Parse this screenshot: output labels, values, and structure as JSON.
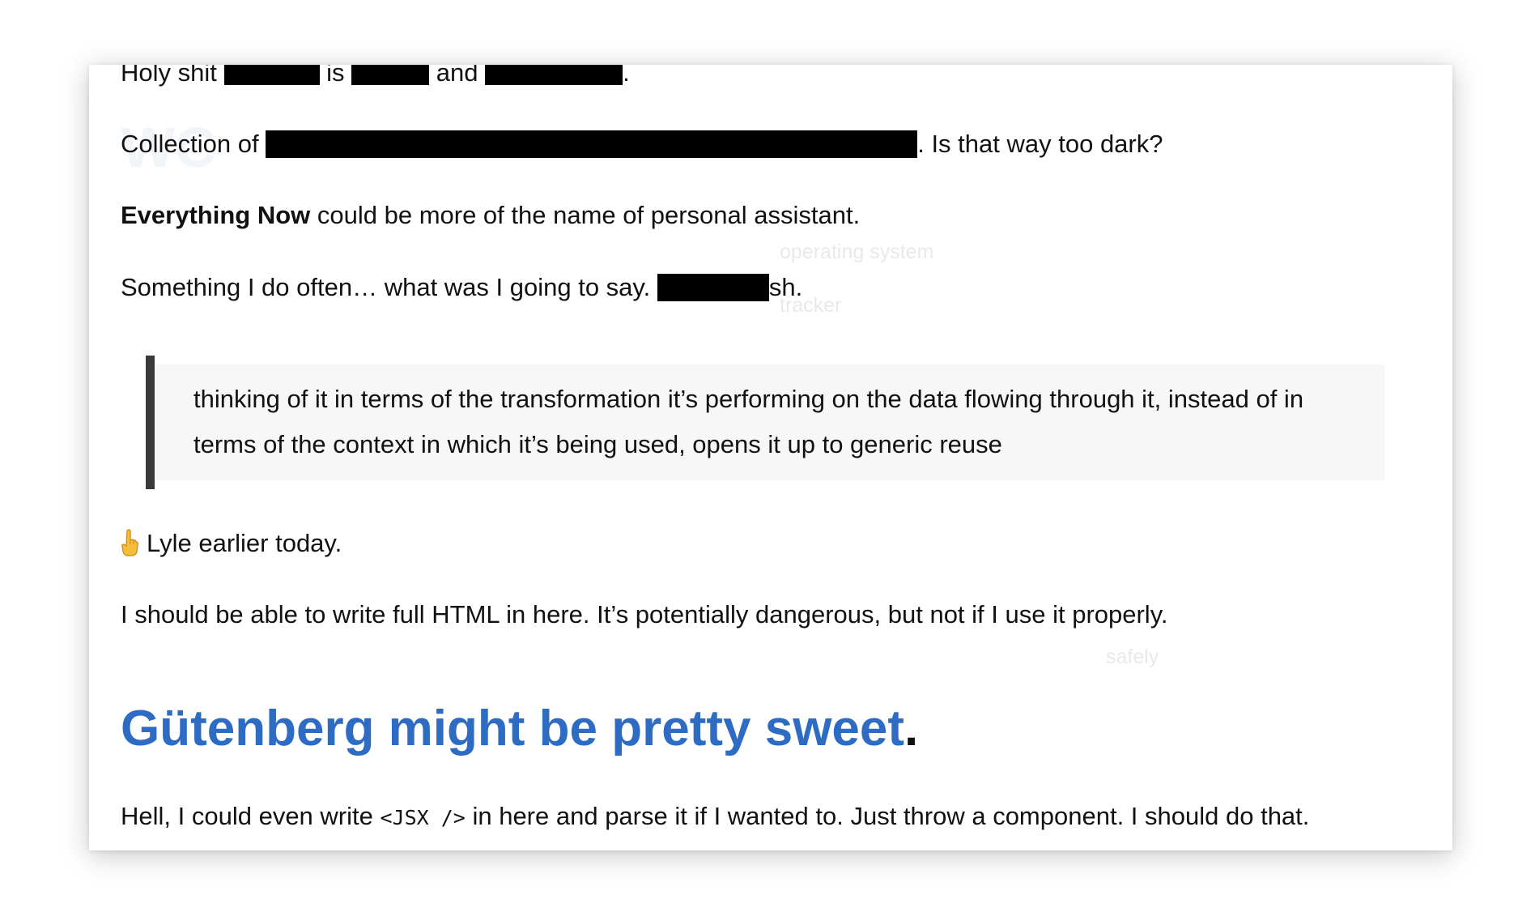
{
  "ghost": {
    "big": "WC",
    "label1": "operating system",
    "label2": "tracker",
    "label3": "safely"
  },
  "para1": {
    "a": "Holy shit",
    "b": "is",
    "c": "and",
    "d": "."
  },
  "para2": {
    "a": "Collection of",
    "b": ". Is that way too dark?"
  },
  "para3": {
    "bold": "Everything Now",
    "rest": " could be more of the name of personal assistant."
  },
  "para4": {
    "a": "Something I do often… what was I going to say. ",
    "b": "sh."
  },
  "blockquote": {
    "text": "thinking of it in terms of the transformation it’s performing on the data flowing through it, instead of in terms of the context in which it’s being used, opens it up to generic reuse"
  },
  "para5": {
    "icon": "pointing-up-hand-icon",
    "text": "Lyle earlier today."
  },
  "para6": {
    "text": "I should be able to write full HTML in here. It’s potentially dangerous, but not if I use it properly."
  },
  "heading": {
    "text": "Gütenberg might be pretty sweet",
    "period": "."
  },
  "para7": {
    "a": "Hell, I could even write ",
    "code": "<JSX />",
    "b": " in here and parse it if I wanted to. Just throw a component. I should do that."
  },
  "colors": {
    "heading": "#2e6cc4",
    "text": "#111111",
    "redaction": "#000000",
    "quote_background": "#f7f7f7",
    "quote_bar": "#3a3a3a"
  }
}
